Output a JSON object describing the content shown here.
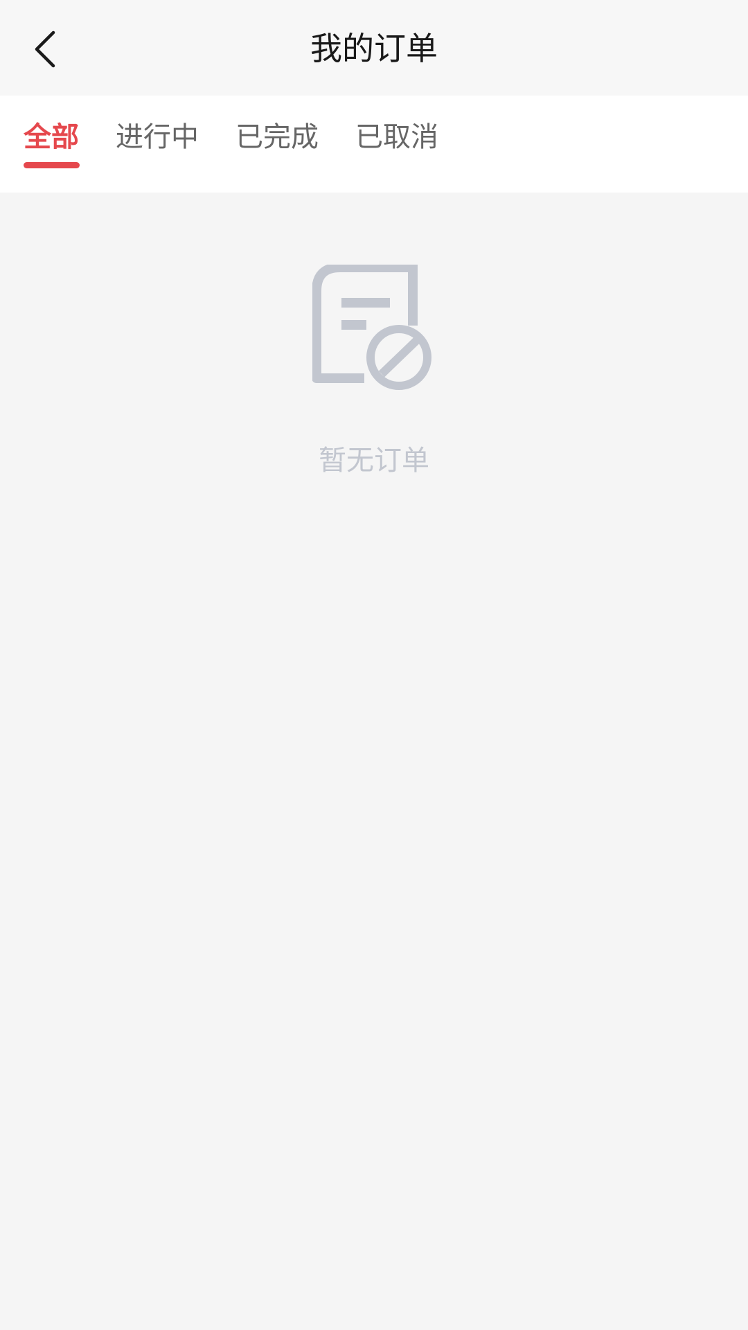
{
  "header": {
    "title": "我的订单",
    "back_icon": "chevron-left-icon"
  },
  "tabs": [
    {
      "label": "全部",
      "active": true
    },
    {
      "label": "进行中",
      "active": false
    },
    {
      "label": "已完成",
      "active": false
    },
    {
      "label": "已取消",
      "active": false
    }
  ],
  "empty_state": {
    "icon": "document-cancel-icon",
    "message": "暂无订单"
  },
  "colors": {
    "accent": "#e5484d",
    "tab_inactive": "#666666",
    "empty_gray": "#c2c6cf",
    "background": "#f5f5f5"
  }
}
